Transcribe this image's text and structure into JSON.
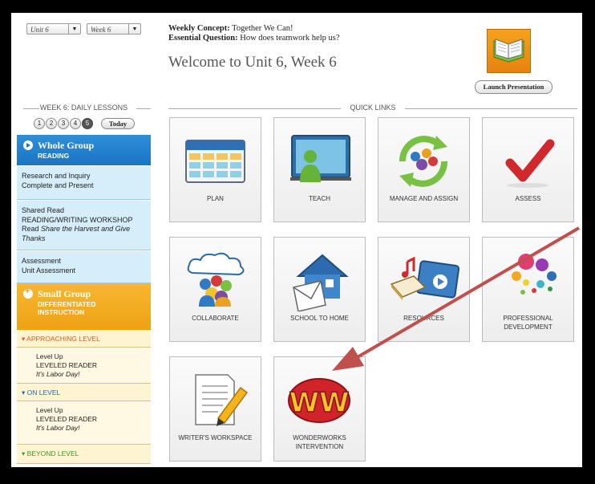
{
  "header": {
    "unit_select": "Unit 6",
    "week_select": "Week 6",
    "concept_label": "Weekly Concept:",
    "concept_value": "Together We Can!",
    "question_label": "Essential Question:",
    "question_value": "How does teamwork help us?",
    "welcome": "Welcome to Unit 6, Week 6",
    "launch_button": "Launch Presentation"
  },
  "lessons": {
    "heading": "WEEK 6: DAILY LESSONS",
    "days": [
      "1",
      "2",
      "3",
      "4",
      "5"
    ],
    "active_day": "5",
    "today_button": "Today"
  },
  "sidebar": {
    "whole_group": {
      "title": "Whole Group",
      "sub": "READING"
    },
    "items": [
      {
        "line1": "Research and Inquiry",
        "line2": "Complete and Present"
      },
      {
        "line1": "Shared Read",
        "line2": "READING/WRITING WORKSHOP",
        "line3_prefix": "Read ",
        "line3_italic": "Share the Harvest and Give",
        "line4_italic": "Thanks"
      },
      {
        "line1": "Assessment",
        "line2": "Unit Assessment"
      }
    ],
    "small_group": {
      "title": "Small Group",
      "sub1": "DIFFERENTIATED",
      "sub2": "INSTRUCTION"
    },
    "levels": [
      {
        "heading": "APPROACHING LEVEL",
        "item1": "Level Up",
        "item2": "LEVELED READER",
        "item3": "It's Labor Day!"
      },
      {
        "heading": "ON LEVEL",
        "item1": "Level Up",
        "item2": "LEVELED READER",
        "item3": "It's Labor Day!"
      },
      {
        "heading": "BEYOND LEVEL"
      }
    ]
  },
  "quick_links": {
    "heading": "QUICK LINKS",
    "tiles": [
      {
        "label": "PLAN",
        "icon": "calendar-icon"
      },
      {
        "label": "TEACH",
        "icon": "whiteboard-teacher-icon"
      },
      {
        "label": "MANAGE AND ASSIGN",
        "icon": "recycle-people-icon"
      },
      {
        "label": "ASSESS",
        "icon": "checkmark-icon"
      },
      {
        "label": "COLLABORATE",
        "icon": "cloud-people-icon"
      },
      {
        "label": "SCHOOL TO HOME",
        "icon": "house-envelope-icon"
      },
      {
        "label": "RESOURCES",
        "icon": "media-book-icon"
      },
      {
        "label": "PROFESSIONAL DEVELOPMENT",
        "icon": "colored-dots-icon"
      },
      {
        "label": "WRITER'S WORKSPACE",
        "icon": "paper-pencil-icon"
      },
      {
        "label": "WONDERWORKS INTERVENTION",
        "icon": "wonderworks-logo-icon"
      }
    ]
  },
  "colors": {
    "whole_group_blue": "#1a74c4",
    "small_group_orange": "#eea112",
    "annotation_arrow": "#c0504d"
  }
}
